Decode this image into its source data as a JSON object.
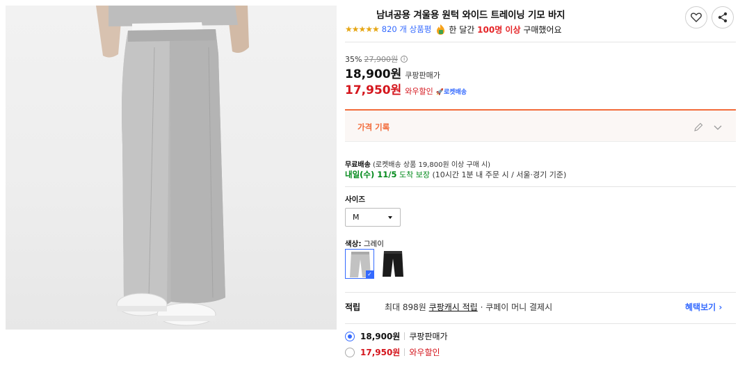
{
  "product": {
    "title": "남녀공용 겨울용 원턱 와이드 트레이닝 기모 바지",
    "stars": "★★★★★",
    "review_count": "820 개 상품평",
    "bought_prefix": "한 달간",
    "bought_highlight": "100명 이상",
    "bought_suffix": "구매했어요"
  },
  "actions": {
    "like_icon": "heart-icon",
    "share_icon": "share-icon"
  },
  "pricing": {
    "discount_rate": "35%",
    "original_price": "27,900원",
    "info_glyph": "i",
    "sale_price": "18,900원",
    "sale_label": "쿠팡판매가",
    "wow_price": "17,950원",
    "wow_label": "와우할인",
    "rocket_badge": "🚀로켓배송"
  },
  "price_history": {
    "label": "가격 기록"
  },
  "shipping": {
    "free_label": "무료배송",
    "free_detail": "(로켓배송 상품 19,800원 이상 구매 시)",
    "arrival_day": "내일(수) 11/5",
    "arrival_guarantee": "도착 보장",
    "arrival_detail": "(10시간 1분 내 주문 시 / 서울·경기 기준)"
  },
  "size": {
    "label": "사이즈",
    "selected": "M"
  },
  "color": {
    "label": "색상:",
    "selected": "그레이",
    "options": [
      "그레이",
      "블랙"
    ]
  },
  "points": {
    "label": "적립",
    "prefix": "최대 898원",
    "link": "쿠팡캐시 적립",
    "suffix": "· 쿠페이 머니 결제시",
    "benefit_link": "혜택보기 ›"
  },
  "price_options": [
    {
      "price": "18,900원",
      "label": "쿠팡판매가",
      "checked": true
    },
    {
      "price": "17,950원",
      "label": "와우할인",
      "checked": false
    }
  ],
  "colors": {
    "accent": "#346aff",
    "red": "#d4151c",
    "orange": "#f26b3a",
    "green": "#00891a"
  }
}
